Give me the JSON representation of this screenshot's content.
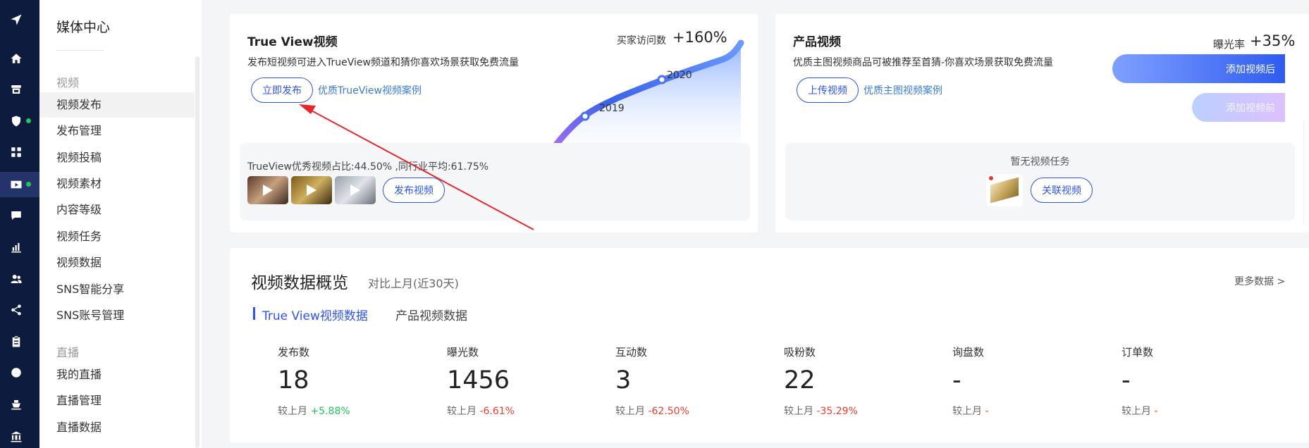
{
  "sidebar": {
    "title": "媒体中心",
    "groups": [
      {
        "label": "视频"
      },
      {
        "label": "直播"
      }
    ],
    "items": [
      {
        "label": "视频发布"
      },
      {
        "label": "发布管理"
      },
      {
        "label": "视频投稿"
      },
      {
        "label": "视频素材"
      },
      {
        "label": "内容等级"
      },
      {
        "label": "视频任务"
      },
      {
        "label": "视频数据"
      },
      {
        "label": "SNS智能分享"
      },
      {
        "label": "SNS账号管理"
      },
      {
        "label": "我的直播"
      },
      {
        "label": "直播管理"
      },
      {
        "label": "直播数据"
      }
    ]
  },
  "rail_icons": [
    "send-icon",
    "home-icon",
    "store-icon",
    "shield-icon",
    "grid-icon",
    "video-icon",
    "chat-icon",
    "chart-icon",
    "users-icon",
    "share-icon",
    "clipboard-icon",
    "globe-icon",
    "ship-icon",
    "bank-icon"
  ],
  "trueview": {
    "title": "True View视频",
    "desc": "发布短视频可进入TrueView频道和猜你喜欢场景获取免费流量",
    "publish_button": "立即发布",
    "example_link": "优质TrueView视频案例",
    "metric_label": "买家访问数",
    "metric_value": "+160%",
    "year_a": "2019",
    "year_b": "2020",
    "stats_text": "TrueView优秀视频占比:44.50% ,同行业平均:61.75%",
    "publish_video_button": "发布视频"
  },
  "product_video": {
    "title": "产品视频",
    "desc": "优质主图视频商品可被推荐至首猜-你喜欢场景获取免费流量",
    "upload_button": "上传视频",
    "example_link": "优质主图视频案例",
    "metric_label": "曝光率",
    "metric_value": "+35%",
    "after_label": "添加视频后",
    "before_label": "添加视频前",
    "empty_text": "暂无视频任务",
    "link_button": "关联视频"
  },
  "overview": {
    "title": "视频数据概览",
    "subtitle": "对比上月(近30天)",
    "more": "更多数据 >",
    "tabs": [
      {
        "label": "True View视频数据"
      },
      {
        "label": "产品视频数据"
      }
    ],
    "compare_label": "较上月",
    "metrics": [
      {
        "label": "发布数",
        "value": "18",
        "change": "+5.88%"
      },
      {
        "label": "曝光数",
        "value": "1456",
        "change": "-6.61%"
      },
      {
        "label": "互动数",
        "value": "3",
        "change": "-62.50%"
      },
      {
        "label": "吸粉数",
        "value": "22",
        "change": "-35.29%"
      },
      {
        "label": "询盘数",
        "value": "-",
        "change": "-"
      },
      {
        "label": "订单数",
        "value": "-",
        "change": "-"
      }
    ]
  },
  "colors": {
    "rail": "#0d1b3e",
    "accent": "#2f54eb",
    "up": "#22c55e",
    "down": "#e8412d",
    "arrow": "#e8262d"
  }
}
